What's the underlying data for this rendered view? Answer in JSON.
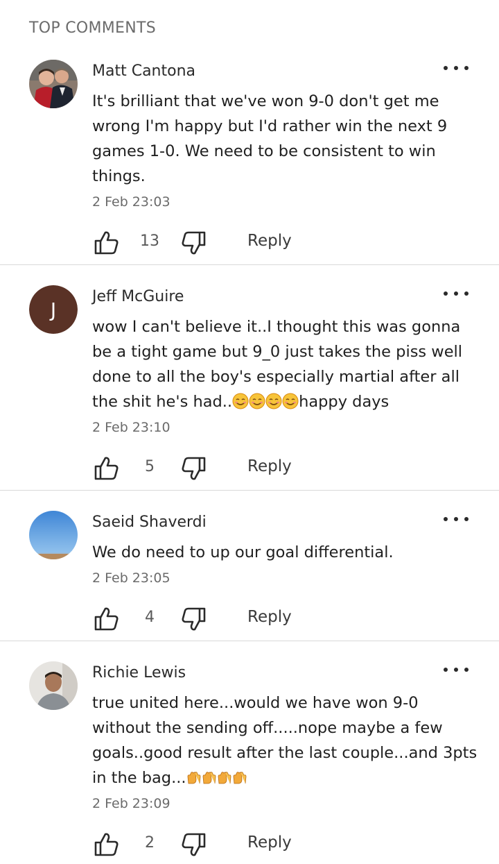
{
  "section_title": "TOP COMMENTS",
  "reply_label": "Reply",
  "comments": [
    {
      "author": "Matt Cantona",
      "avatar": "photo-avatar-two-men",
      "text": "It's brilliant that we've won 9-0 don't get me wrong I'm happy but I'd rather win the next 9 games 1-0. We need to be consistent to win things.",
      "time": "2 Feb 23:03",
      "likes": "13"
    },
    {
      "author": "Jeff McGuire",
      "avatar_letter": "J",
      "text_before": "wow I can't believe it..I thought this was gonna be a tight game but 9_0 just takes the piss well done to all the boy's especially martial after all the shit he's had..",
      "text_after": "happy days",
      "emoji": "smiling-face-emoji",
      "time": "2 Feb 23:10",
      "likes": "5"
    },
    {
      "author": "Saeid Shaverdi",
      "avatar": "photo-avatar-sky",
      "text": "We do need to up our goal differential.",
      "time": "2 Feb 23:05",
      "likes": "4"
    },
    {
      "author": "Richie Lewis",
      "avatar": "photo-avatar-person",
      "text": "true united here...would we have won 9-0 without the sending off.....nope maybe a few goals..good result after the last couple...and 3pts in the bag...",
      "emoji": "clapping-hands-emoji",
      "time": "2 Feb 23:09",
      "likes": "2"
    }
  ],
  "colors": {
    "text": "#1f1f1f",
    "secondary": "#6b6b6b",
    "divider": "#d9d9d9",
    "letter_avatar_bg": "#5a3226"
  }
}
